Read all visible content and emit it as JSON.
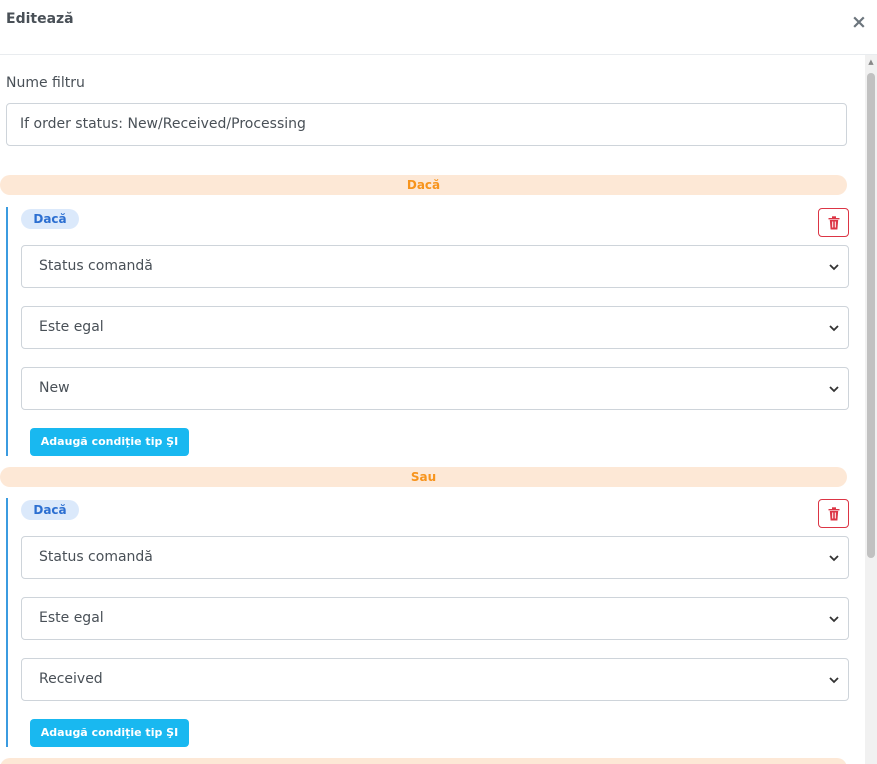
{
  "modal": {
    "title": "Editează",
    "close_glyph": "×"
  },
  "form": {
    "name_label": "Nume filtru",
    "name_value": "If order status: New/Received/Processing"
  },
  "dividers": [
    "Dacă",
    "Sau"
  ],
  "groups": [
    {
      "badge": "Dacă",
      "field": "Status comandă",
      "operator": "Este egal",
      "value": "New",
      "add_label": "Adaugă condiție tip ŞI"
    },
    {
      "badge": "Dacă",
      "field": "Status comandă",
      "operator": "Este egal",
      "value": "Received",
      "add_label": "Adaugă condiție tip ŞI"
    }
  ],
  "icons": {
    "delete": "trash-icon",
    "dropdown": "chevron-down-icon",
    "close": "close-icon"
  },
  "colors": {
    "accent_blue": "#19b8f0",
    "divider_bg": "#fde8d6",
    "divider_text": "#f7941d",
    "badge_bg": "#dbe9fb",
    "badge_text": "#2c6fd1",
    "danger": "#dc3545",
    "group_border": "#3b9be0"
  }
}
